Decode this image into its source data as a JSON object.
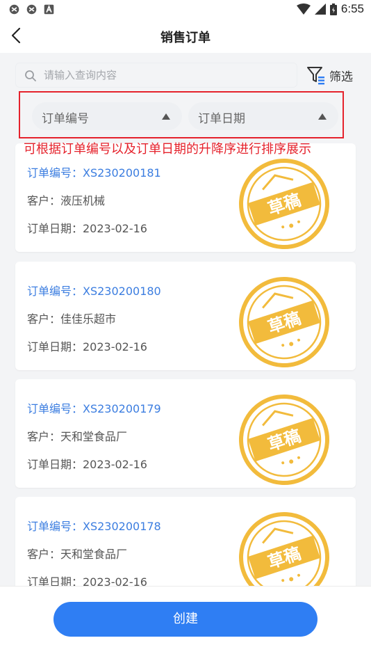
{
  "status_bar": {
    "time": "6:55"
  },
  "header": {
    "title": "销售订单"
  },
  "search": {
    "placeholder": "请输入查询内容"
  },
  "filter": {
    "label": "筛选"
  },
  "sort": {
    "options": [
      {
        "label": "订单编号"
      },
      {
        "label": "订单日期"
      }
    ]
  },
  "annotation": "可根据订单编号以及订单日期的升降序进行排序展示",
  "stamp_text": "草稿",
  "orders": [
    {
      "number": "订单编号：XS230200181",
      "customer": "客户：液压机械",
      "date": "订单日期：2023-02-16"
    },
    {
      "number": "订单编号：XS230200180",
      "customer": "客户：佳佳乐超市",
      "date": "订单日期：2023-02-16"
    },
    {
      "number": "订单编号：XS230200179",
      "customer": "客户：天和堂食品厂",
      "date": "订单日期：2023-02-16"
    },
    {
      "number": "订单编号：XS230200178",
      "customer": "客户：天和堂食品厂",
      "date": "订单日期：2023-02-16"
    }
  ],
  "footer": {
    "create_label": "创建"
  },
  "colors": {
    "accent": "#2f7ef3",
    "link": "#3b7de0",
    "annotation": "#e5222c",
    "stamp": "#f2bb3c"
  }
}
